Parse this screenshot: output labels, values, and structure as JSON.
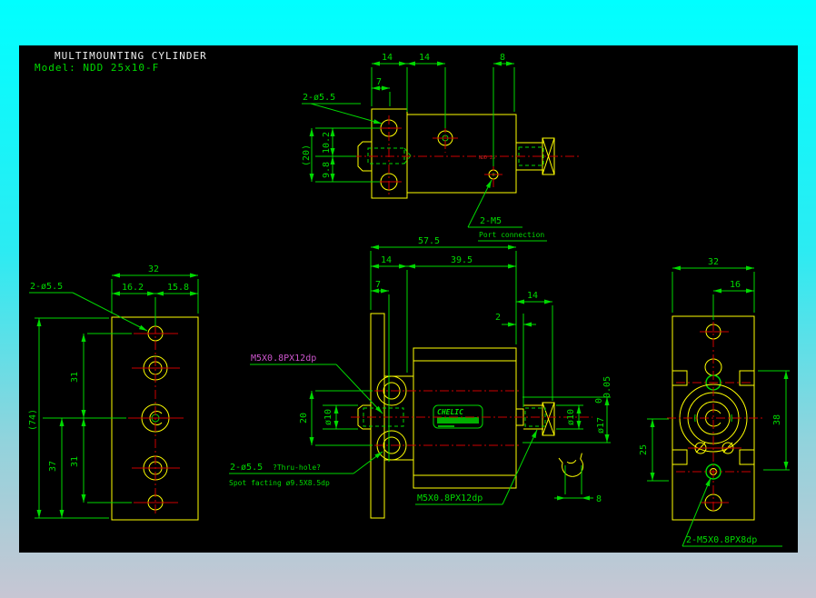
{
  "title": "MULTIMOUNTING CYLINDER",
  "model": "Model: NDD 25x10-F",
  "colors": {
    "background_top": "#00ffff",
    "background_bottom": "#c7c6d3",
    "canvas": "#000000",
    "outline": "#ffff00",
    "dimension": "#00d900",
    "centerline": "#cc0000",
    "highlight_label": "#cc55cc",
    "title_text": "#f0f0f0"
  },
  "top_view": {
    "dims": {
      "w14a": "14",
      "w14b": "14",
      "w8": "8",
      "w7": "7",
      "h20": "(20)",
      "h10_2": "10.2",
      "h9_8": "9.8"
    },
    "labels": {
      "holes": "2-ø5.5",
      "port": "2-M5",
      "port_note": "Port connection",
      "body_mark": "NDD 25"
    }
  },
  "front_view": {
    "dims": {
      "w57_5": "57.5",
      "w14": "14",
      "w39_5": "39.5",
      "w7": "7",
      "rod14": "14",
      "gap2": "2",
      "h20": "20",
      "d10_left": "ø10",
      "d10_right": "ø10",
      "d17": "ø17",
      "d17_tol_upper": "0",
      "d17_tol_lower": "-0.05",
      "flats8": "8"
    },
    "labels": {
      "thread_left": "M5X0.8PX12dp",
      "thread_right": "M5X0.8PX12dp",
      "holes": "2-ø5.5",
      "holes_note": "?Thru-hole?",
      "spotface": "Spot facting ø9.5X8.5dp",
      "logo": "CHELIC"
    }
  },
  "side_view": {
    "dims": {
      "w32": "32",
      "w16_2": "16.2",
      "w15_8": "15.8",
      "h74": "(74)",
      "h37": "37",
      "h31a": "31",
      "h31b": "31"
    },
    "labels": {
      "holes": "2-ø5.5"
    }
  },
  "rear_view": {
    "dims": {
      "w32": "32",
      "w16": "16",
      "h38": "38",
      "h25": "25"
    },
    "labels": {
      "thread": "2-M5X0.8PX8dp"
    }
  }
}
